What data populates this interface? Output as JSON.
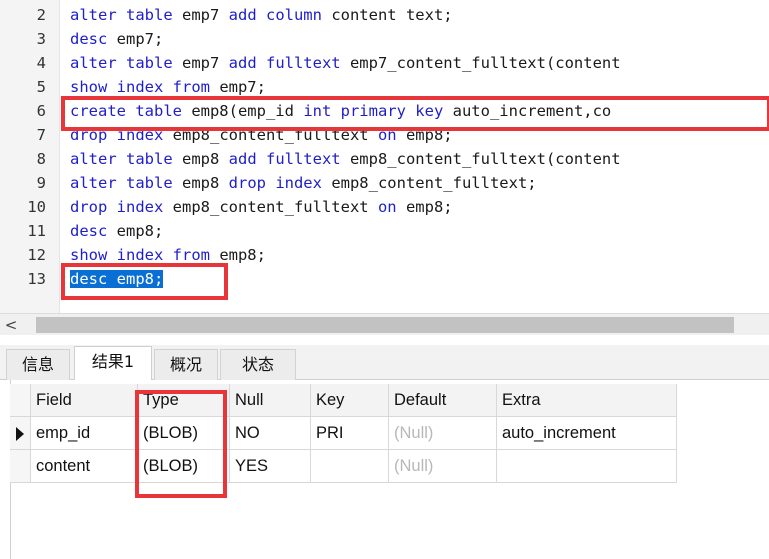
{
  "editor": {
    "lines": [
      {
        "num": "2",
        "tokens": [
          [
            "kw",
            "alter table"
          ],
          [
            "tx",
            " emp7 "
          ],
          [
            "kw",
            "add column"
          ],
          [
            "tx",
            " content text;"
          ]
        ]
      },
      {
        "num": "3",
        "tokens": [
          [
            "kw",
            "desc"
          ],
          [
            "tx",
            " emp7;"
          ]
        ]
      },
      {
        "num": "4",
        "tokens": [
          [
            "kw",
            "alter table"
          ],
          [
            "tx",
            " emp7 "
          ],
          [
            "kw",
            "add fulltext"
          ],
          [
            "tx",
            " emp7_content_fulltext(content"
          ]
        ]
      },
      {
        "num": "5",
        "tokens": [
          [
            "kw",
            "show index from"
          ],
          [
            "tx",
            " emp7;"
          ]
        ]
      },
      {
        "num": "6",
        "tokens": [
          [
            "kw",
            "create table"
          ],
          [
            "tx",
            " emp8(emp_id "
          ],
          [
            "kw",
            "int primary key"
          ],
          [
            "tx",
            " auto_increment,co"
          ]
        ]
      },
      {
        "num": "7",
        "tokens": [
          [
            "kw",
            "drop index"
          ],
          [
            "tx",
            " emp8_content_fulltext "
          ],
          [
            "kw",
            "on"
          ],
          [
            "tx",
            " emp8;"
          ]
        ]
      },
      {
        "num": "8",
        "tokens": [
          [
            "kw",
            "alter table"
          ],
          [
            "tx",
            " emp8 "
          ],
          [
            "kw",
            "add fulltext"
          ],
          [
            "tx",
            " emp8_content_fulltext(content"
          ]
        ]
      },
      {
        "num": "9",
        "tokens": [
          [
            "kw",
            "alter table"
          ],
          [
            "tx",
            " emp8 "
          ],
          [
            "kw",
            "drop index"
          ],
          [
            "tx",
            " emp8_content_fulltext;"
          ]
        ]
      },
      {
        "num": "10",
        "tokens": [
          [
            "kw",
            "drop index"
          ],
          [
            "tx",
            " emp8_content_fulltext "
          ],
          [
            "kw",
            "on"
          ],
          [
            "tx",
            " emp8;"
          ]
        ]
      },
      {
        "num": "11",
        "tokens": [
          [
            "kw",
            "desc"
          ],
          [
            "tx",
            " emp8;"
          ]
        ]
      },
      {
        "num": "12",
        "tokens": [
          [
            "kw",
            "show index from"
          ],
          [
            "tx",
            " emp8;"
          ]
        ]
      },
      {
        "num": "13",
        "tokens": [
          [
            "sel",
            "desc emp8;"
          ]
        ]
      }
    ]
  },
  "scrollbar": {
    "left_arrow": "<"
  },
  "tabs": [
    {
      "label": "信息",
      "active": false
    },
    {
      "label": "结果1",
      "active": true
    },
    {
      "label": "概况",
      "active": false
    },
    {
      "label": "状态",
      "active": false
    }
  ],
  "result": {
    "columns": [
      "Field",
      "Type",
      "Null",
      "Key",
      "Default",
      "Extra"
    ],
    "rows": [
      [
        "emp_id",
        "(BLOB)",
        "NO",
        "PRI",
        "(Null)",
        "auto_increment"
      ],
      [
        "content",
        "(BLOB)",
        "YES",
        "",
        "(Null)",
        ""
      ]
    ],
    "null_text": "(Null)"
  },
  "colors": {
    "keyword": "#1e1ecc",
    "selection": "#0a6fd4",
    "annotation_box": "#e8353a"
  }
}
